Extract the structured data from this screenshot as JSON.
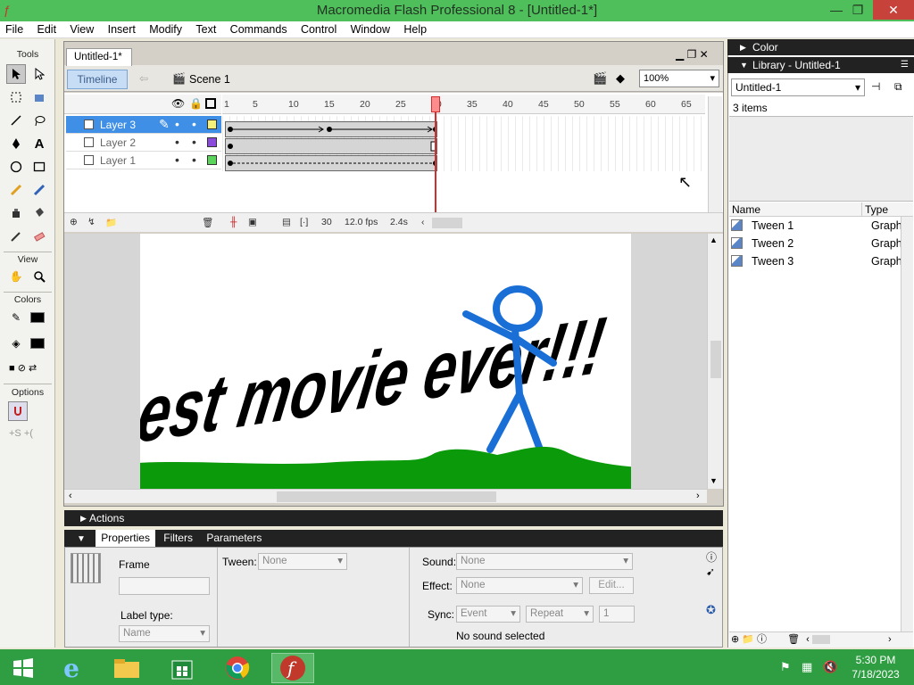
{
  "window": {
    "title": "Macromedia Flash Professional 8 - [Untitled-1*]"
  },
  "menu": [
    "File",
    "Edit",
    "View",
    "Insert",
    "Modify",
    "Text",
    "Commands",
    "Control",
    "Window",
    "Help"
  ],
  "tools": {
    "title": "Tools",
    "view": "View",
    "colors": "Colors",
    "options": "Options"
  },
  "document": {
    "tab": "Untitled-1*",
    "timeline_button": "Timeline",
    "scene": "Scene 1",
    "zoom": "100%"
  },
  "timeline": {
    "layers": [
      {
        "name": "Layer 3",
        "color": "#f5f07a",
        "selected": true
      },
      {
        "name": "Layer 2",
        "color": "#8a4bdc",
        "selected": false
      },
      {
        "name": "Layer 1",
        "color": "#5bd45b",
        "selected": false
      }
    ],
    "ruler": [
      "1",
      "5",
      "10",
      "15",
      "20",
      "25",
      "30",
      "35",
      "40",
      "45",
      "50",
      "55",
      "60",
      "65"
    ],
    "current_frame": "30",
    "frame_rate": "12.0 fps",
    "elapsed": "2.4s"
  },
  "stage": {
    "text": "best movie ever!!!",
    "figure_color": "#1a6fd6",
    "ground_color": "#0a9a0a"
  },
  "panels": {
    "actions": "Actions",
    "tabs": [
      "Properties",
      "Filters",
      "Parameters"
    ],
    "frame_label": "Frame",
    "label_type_label": "Label type:",
    "label_type_value": "Name",
    "tween_label": "Tween:",
    "tween_value": "None",
    "sound_label": "Sound:",
    "sound_value": "None",
    "effect_label": "Effect:",
    "effect_value": "None",
    "edit_button": "Edit...",
    "sync_label": "Sync:",
    "sync_value": "Event",
    "repeat_value": "Repeat",
    "repeat_count": "1",
    "sound_status": "No sound selected"
  },
  "library": {
    "color_title": "Color",
    "title": "Library - Untitled-1",
    "selector": "Untitled-1",
    "count": "3 items",
    "col_name": "Name",
    "col_type": "Type",
    "items": [
      {
        "name": "Tween 1",
        "type": "Graph"
      },
      {
        "name": "Tween 2",
        "type": "Graph"
      },
      {
        "name": "Tween 3",
        "type": "Graph"
      }
    ]
  },
  "taskbar": {
    "time": "5:30 PM",
    "date": "7/18/2023"
  }
}
